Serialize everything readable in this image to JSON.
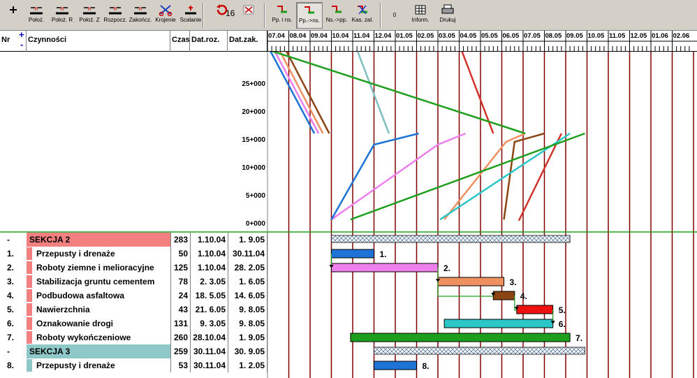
{
  "toolbar": {
    "buttons": [
      {
        "label": "",
        "icon": "plus-icon"
      },
      {
        "label": "Położ.",
        "icon": "position-start-icon"
      },
      {
        "label": "Położ. R",
        "icon": "position-r-icon"
      },
      {
        "label": "Położ. Z",
        "icon": "position-z-icon"
      },
      {
        "label": "Rozpocz.",
        "icon": "start-icon"
      },
      {
        "label": "Zakończ.",
        "icon": "finish-icon"
      },
      {
        "label": "Krojenie",
        "icon": "scissors-icon"
      },
      {
        "label": "Scalanie",
        "icon": "merge-icon"
      },
      {
        "label": "16",
        "icon": "refresh-icon"
      },
      {
        "label": "",
        "icon": "delete-icon"
      },
      {
        "label": "Pp. i ns.",
        "icon": "link-pp-ns-icon"
      },
      {
        "label": "Pp.->ns.",
        "icon": "link-pp-to-ns-icon"
      },
      {
        "label": "Ns.->pp.",
        "icon": "link-ns-to-pp-icon"
      },
      {
        "label": "Kas. zal.",
        "icon": "delete-link-icon"
      },
      {
        "label": "0",
        "icon": ""
      },
      {
        "label": "Inform.",
        "icon": "grid-icon"
      },
      {
        "label": "Drukuj",
        "icon": "printer-icon"
      }
    ]
  },
  "header": {
    "nr": "Nr",
    "plus": "+",
    "minus": "-",
    "czynnosci": "Czynności",
    "czas": "Czas",
    "datroz": "Dat.roz.",
    "datzak": "Dat.zak.",
    "dates": [
      "07.04",
      "08.04",
      "09.04",
      "10.04",
      "11.04",
      "12.04",
      "01.05",
      "02.05",
      "03.05",
      "04.05",
      "05.05",
      "06.05",
      "07.05",
      "08.05",
      "09.05",
      "10.05",
      "11.05",
      "12.05",
      "01.06",
      "02.06"
    ]
  },
  "chart_data": {
    "type": "line",
    "y_ticks": [
      "0+000",
      "5+000",
      "10+000",
      "15+000",
      "20+000",
      "25+000"
    ],
    "ylim": [
      0,
      30000
    ],
    "grid": "vertical lines at each month boundary",
    "series": [
      {
        "color": "#d0342c",
        "points": [
          [
            9.1,
            31000
          ],
          [
            10.6,
            16000
          ]
        ]
      },
      {
        "color": "#d0342c",
        "points": [
          [
            11.8,
            400
          ],
          [
            13.8,
            16000
          ]
        ]
      },
      {
        "color": "#8b4513",
        "points": [
          [
            0.85,
            31000
          ],
          [
            2.9,
            16000
          ]
        ]
      },
      {
        "color": "#8b4513",
        "points": [
          [
            11.1,
            600
          ],
          [
            11.6,
            14500
          ],
          [
            13.0,
            16000
          ]
        ]
      },
      {
        "color": "#ee9060",
        "points": [
          [
            0.55,
            31000
          ],
          [
            2.6,
            16000
          ]
        ]
      },
      {
        "color": "#ee9060",
        "points": [
          [
            8.3,
            600
          ],
          [
            11.2,
            14500
          ],
          [
            12.1,
            16000
          ]
        ]
      },
      {
        "color": "#ee80ee",
        "points": [
          [
            0.3,
            31000
          ],
          [
            2.4,
            16000
          ]
        ]
      },
      {
        "color": "#ee80ee",
        "points": [
          [
            3.0,
            600
          ],
          [
            8.0,
            14000
          ],
          [
            9.3,
            16000
          ]
        ]
      },
      {
        "color": "#1e74d6",
        "points": [
          [
            0.1,
            31000
          ],
          [
            2.2,
            16000
          ]
        ]
      },
      {
        "color": "#1e74d6",
        "points": [
          [
            3.0,
            600
          ],
          [
            5.0,
            14000
          ],
          [
            7.1,
            16000
          ]
        ]
      },
      {
        "color": "#7fbfbf",
        "points": [
          [
            4.2,
            31000
          ],
          [
            5.7,
            16000
          ]
        ]
      },
      {
        "color": "#2bc6c6",
        "points": [
          [
            8.1,
            600
          ],
          [
            14.2,
            16000
          ]
        ]
      },
      {
        "color": "#1d9e1d",
        "points": [
          [
            0.0,
            31000
          ],
          [
            12.1,
            16000
          ]
        ]
      },
      {
        "color": "#1d9e1d",
        "points": [
          [
            3.9,
            600
          ],
          [
            14.9,
            16000
          ]
        ]
      }
    ]
  },
  "rows": [
    {
      "type": "section",
      "nr": "-",
      "name": "SEKCJA 2",
      "czas": "283",
      "droz": "1.10.04",
      "dzak": "1. 9.05",
      "color": "#f28080",
      "bar": {
        "start": 3.0,
        "end": 14.2,
        "style": "hatch"
      }
    },
    {
      "type": "task",
      "nr": "1.",
      "name": "Przepusty i drenaże",
      "czas": "50",
      "droz": "1.10.04",
      "dzak": "30.11.04",
      "color": "#f28080",
      "bar": {
        "start": 3.0,
        "end": 5.0,
        "color": "#1e74d6",
        "label": "1."
      }
    },
    {
      "type": "task",
      "nr": "2.",
      "name": "Roboty ziemne i melioracyjne",
      "czas": "125",
      "droz": "1.10.04",
      "dzak": "28. 2.05",
      "color": "#f28080",
      "bar": {
        "start": 3.0,
        "end": 8.0,
        "color": "#ee80ee",
        "label": "2."
      }
    },
    {
      "type": "task",
      "nr": "3.",
      "name": "Stabilizacja gruntu cementem",
      "czas": "78",
      "droz": "2. 3.05",
      "dzak": "1. 6.05",
      "color": "#f28080",
      "bar": {
        "start": 8.0,
        "end": 11.1,
        "color": "#ee9060",
        "label": "3."
      }
    },
    {
      "type": "task",
      "nr": "4.",
      "name": "Podbudowa asfaltowa",
      "czas": "24",
      "droz": "18. 5.05",
      "dzak": "14. 6.05",
      "color": "#f28080",
      "bar": {
        "start": 10.6,
        "end": 11.6,
        "color": "#8b4513",
        "label": "4."
      }
    },
    {
      "type": "task",
      "nr": "5.",
      "name": "Nawierzchnia",
      "czas": "43",
      "droz": "21. 6.05",
      "dzak": "9. 8.05",
      "color": "#f28080",
      "bar": {
        "start": 11.7,
        "end": 13.4,
        "color": "#ee1111",
        "label": "5."
      }
    },
    {
      "type": "task",
      "nr": "6.",
      "name": "Oznakowanie drogi",
      "czas": "131",
      "droz": "9. 3.05",
      "dzak": "9. 8.05",
      "color": "#f28080",
      "bar": {
        "start": 8.3,
        "end": 13.4,
        "color": "#2bc6c6",
        "label": "6."
      }
    },
    {
      "type": "task",
      "nr": "7.",
      "name": "Roboty wykończeniowe",
      "czas": "260",
      "droz": "28.10.04",
      "dzak": "1. 9.05",
      "color": "#f28080",
      "bar": {
        "start": 3.9,
        "end": 14.2,
        "color": "#1d9e1d",
        "label": "7."
      }
    },
    {
      "type": "section",
      "nr": "-",
      "name": "SEKCJA 3",
      "czas": "259",
      "droz": "30.11.04",
      "dzak": "30. 9.05",
      "color": "#8fc8c8",
      "bar": {
        "start": 5.0,
        "end": 14.9,
        "style": "hatch"
      }
    },
    {
      "type": "task",
      "nr": "8.",
      "name": "Przepusty i drenaże",
      "czas": "53",
      "droz": "30.11.04",
      "dzak": "1. 2.05",
      "color": "#8fc8c8",
      "bar": {
        "start": 5.0,
        "end": 7.0,
        "color": "#1e74d6",
        "label": "8."
      }
    }
  ]
}
